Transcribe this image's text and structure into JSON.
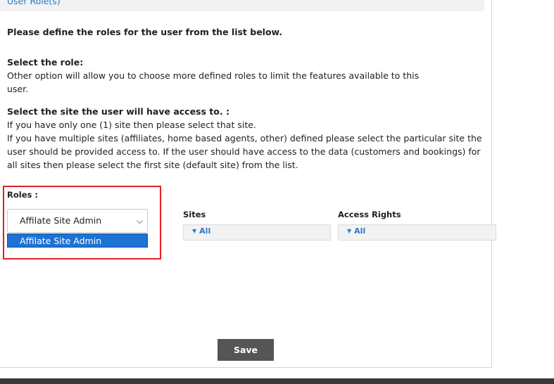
{
  "section": {
    "title": "User Role(s)"
  },
  "intro": "Please define the roles for the user from the list below.",
  "role_help": {
    "heading": "Select the role:",
    "text": "Other option will allow you to choose more defined roles to limit the features available to this user."
  },
  "site_help": {
    "heading": "Select the site the user will have access to. :",
    "line1": "If you have only one (1) site then please select that site.",
    "line2": "If you have multiple sites (affiliates, home based agents, other) defined please select the particular site the user should be provided access to. If the user should have access to the data (customers and bookings) for all sites then please select the first site (default site) from the list."
  },
  "roles": {
    "label": "Roles :",
    "selected": "Affilate Site Admin",
    "options": [
      "Affilate Site Admin"
    ]
  },
  "sites": {
    "label": "Sites",
    "value": "All"
  },
  "access_rights": {
    "label": "Access Rights",
    "value": "All"
  },
  "save_label": "Save",
  "colors": {
    "accent": "#2b7bc6",
    "highlight": "#e31f26",
    "option_bg": "#1e72d4",
    "button_bg": "#555555"
  }
}
